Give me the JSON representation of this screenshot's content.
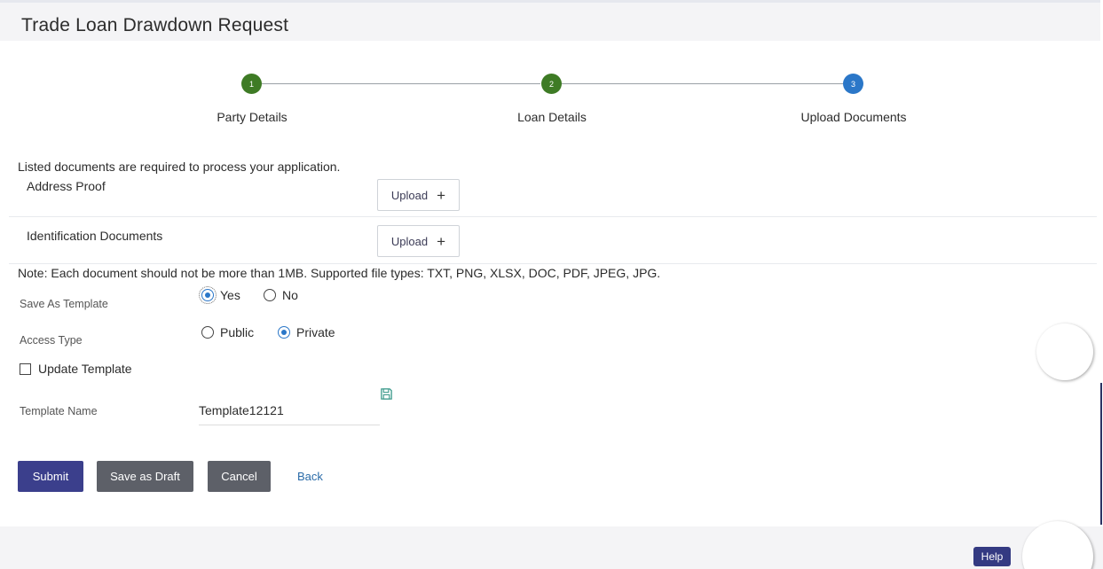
{
  "page": {
    "title": "Trade Loan Drawdown Request"
  },
  "stepper": {
    "steps": [
      {
        "number": "1",
        "label": "Party Details",
        "state": "complete"
      },
      {
        "number": "2",
        "label": "Loan Details",
        "state": "complete"
      },
      {
        "number": "3",
        "label": "Upload Documents",
        "state": "active"
      }
    ]
  },
  "documents": {
    "intro": "Listed documents are required to process your application.",
    "items": [
      {
        "name": "Address Proof",
        "upload_label": "Upload"
      },
      {
        "name": "Identification Documents",
        "upload_label": "Upload"
      }
    ],
    "note": "Note: Each document should not be more than 1MB. Supported file types: TXT, PNG, XLSX, DOC, PDF, JPEG, JPG."
  },
  "template": {
    "save_as_label": "Save As Template",
    "save_as_options": [
      "Yes",
      "No"
    ],
    "save_as_selected": "Yes",
    "access_type_label": "Access Type",
    "access_type_options": [
      "Public",
      "Private"
    ],
    "access_type_selected": "Private",
    "update_label": "Update Template",
    "update_checked": false,
    "name_label": "Template Name",
    "name_value": "Template12121"
  },
  "actions": {
    "submit": "Submit",
    "save_draft": "Save as Draft",
    "cancel": "Cancel",
    "back": "Back"
  },
  "footer": {
    "help": "Help"
  },
  "colors": {
    "step_complete": "#3e7b25",
    "step_active": "#2b77c8",
    "primary_button": "#3b3f8c",
    "secondary_button": "#5d6068",
    "link": "#2a6ba8"
  }
}
